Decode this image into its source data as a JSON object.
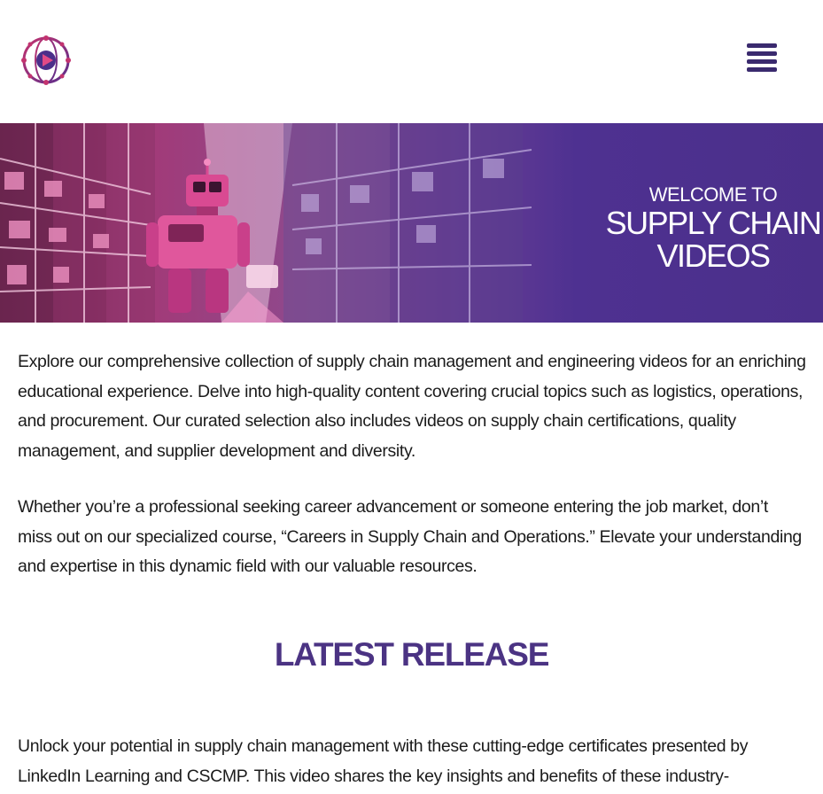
{
  "header": {
    "logo_icon": "globe-play-logo",
    "menu_icon": "hamburger-menu-icon"
  },
  "hero": {
    "subtitle": "WELCOME TO",
    "title_line1": "SUPPLY CHAIN",
    "title_line2": "VIDEOS",
    "image_description_icon": "warehouse-robot-image"
  },
  "intro": {
    "paragraph1": "Explore our comprehensive collection of supply chain management and engineering videos for an enriching educational experience. Delve into high-quality content covering crucial topics such as logistics, operations, and procurement. Our curated selection also includes videos on supply chain certifications, quality management, and supplier development and diversity.",
    "paragraph2": "Whether you’re a professional seeking career advancement or someone entering the job market, don’t miss out on our specialized course, “Careers in Supply Chain and Operations.” Elevate your understanding and expertise in this dynamic field with our valuable resources."
  },
  "latest_release": {
    "heading": "LATEST RELEASE",
    "description": "Unlock your potential in supply chain management with these cutting-edge certificates presented by LinkedIn Learning and CSCMP. This video shares the key insights and benefits of these industry-"
  },
  "colors": {
    "brand_purple": "#4b3383",
    "hero_magenta": "#a23a78",
    "menu_icon": "#3a2a6e"
  }
}
